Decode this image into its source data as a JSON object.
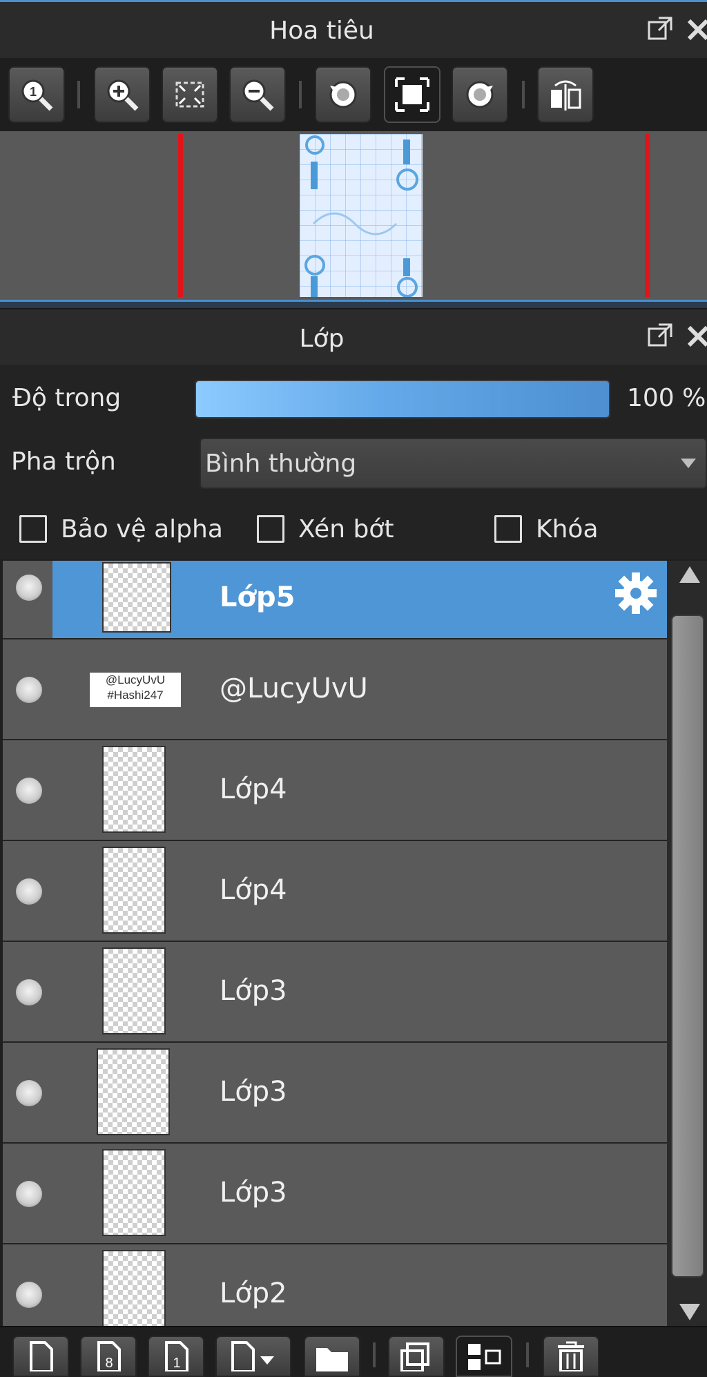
{
  "navigator": {
    "title": "Hoa tiêu",
    "toolbar_icons": [
      "zoom-actual-icon",
      "zoom-in-icon",
      "fit-screen-icon",
      "zoom-out-icon",
      "rotate-left-icon",
      "fullscreen-icon",
      "rotate-right-icon",
      "flip-horizontal-icon"
    ]
  },
  "layers_panel": {
    "title": "Lớp",
    "opacity_label": "Độ trong",
    "opacity_value": "100 %",
    "opacity_percent": 100,
    "blend_label": "Pha trộn",
    "blend_value": "Bình thường",
    "protect_alpha_label": "Bảo vệ alpha",
    "clipping_label": "Xén bớt",
    "lock_label": "Khóa",
    "layers": [
      {
        "name": "Lớp5",
        "selected": true
      },
      {
        "name": "@LucyUvU",
        "selected": false
      },
      {
        "name": "Lớp4",
        "selected": false
      },
      {
        "name": "Lớp4",
        "selected": false
      },
      {
        "name": "Lớp3",
        "selected": false
      },
      {
        "name": "Lớp3",
        "selected": false
      },
      {
        "name": "Lớp3",
        "selected": false
      },
      {
        "name": "Lớp2",
        "selected": false
      }
    ],
    "text_layer_thumb_lines": [
      "@LucyUvU",
      "#Hashi247"
    ],
    "bottom_icons": [
      "new-layer-icon",
      "new-layer-8bit-icon",
      "new-layer-1bit-icon",
      "add-layer-menu-icon",
      "new-folder-icon",
      "duplicate-layer-icon",
      "merge-down-icon",
      "delete-layer-icon"
    ]
  },
  "colors": {
    "accent": "#4f96d6",
    "redline": "#e0151a"
  }
}
